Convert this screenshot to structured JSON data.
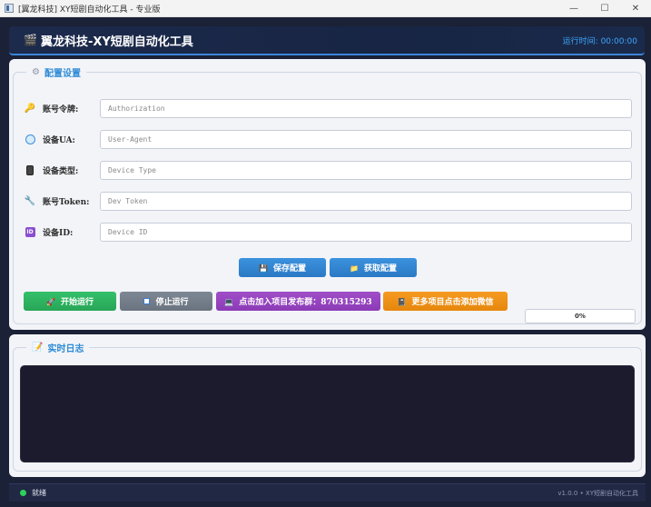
{
  "window": {
    "title": "[翼龙科技] XY短剧自动化工具 - 专业版",
    "controls": {
      "minimize": "—",
      "maximize": "☐",
      "close": "✕"
    }
  },
  "header": {
    "logo_icon": "clapperboard-icon",
    "title": "翼龙科技-XY短剧自动化工具",
    "runtime": "运行时间: 00:00:00"
  },
  "config": {
    "legend": "配置设置",
    "legend_icon": "gear-icon",
    "fields": [
      {
        "icon": "key-icon",
        "label": "账号令牌:",
        "placeholder": "Authorization",
        "value": ""
      },
      {
        "icon": "globe-icon",
        "label": "设备UA:",
        "placeholder": "User-Agent",
        "value": ""
      },
      {
        "icon": "phone-icon",
        "label": "设备类型:",
        "placeholder": "Device Type",
        "value": ""
      },
      {
        "icon": "wrench-icon",
        "label": "账号Token:",
        "placeholder": "Dev Token",
        "value": ""
      },
      {
        "icon": "id-icon",
        "label": "设备ID:",
        "placeholder": "Device ID",
        "value": ""
      }
    ],
    "save_button": "保存配置",
    "fetch_button": "获取配置"
  },
  "actions": {
    "start": "开始运行",
    "stop": "停止运行",
    "join_group": "点击加入项目发布群：870315293",
    "more_projects": "更多项目点击添加微信",
    "progress_text": "0%",
    "progress_value": 0
  },
  "log": {
    "legend": "实时日志",
    "legend_icon": "notepad-icon"
  },
  "status": {
    "text": "就绪",
    "version": "v1.0.0 • XY短剧自动化工具"
  },
  "colors": {
    "accent": "#3b92de",
    "start": "#35c06a",
    "stop": "#7e8794",
    "join": "#a04ec8",
    "more": "#f59a22",
    "status_ok": "#2fd15a"
  }
}
